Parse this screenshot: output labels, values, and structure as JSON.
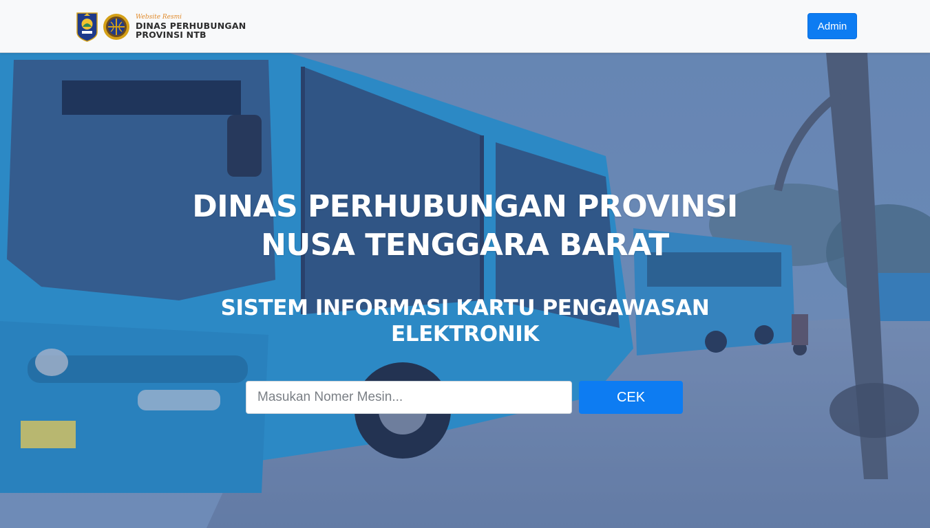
{
  "navbar": {
    "brand": {
      "tagline": "Website Resmi",
      "line1": "DINAS PERHUBUNGAN",
      "line2": "PROVINSI NTB",
      "icons": [
        "ntb-province-emblem-icon",
        "dishub-logo-icon"
      ]
    },
    "admin_label": "Admin"
  },
  "hero": {
    "title_line1": "DINAS PERHUBUNGAN PROVINSI",
    "title_line2": "NUSA TENGGARA BARAT",
    "subtitle_line1": "SISTEM INFORMASI KARTU PENGAWASAN",
    "subtitle_line2": "ELEKTRONIK",
    "search": {
      "placeholder": "Masukan Nomer Mesin...",
      "value": "",
      "button_label": "CEK"
    },
    "background": "bus-station-photo"
  },
  "colors": {
    "primary": "#0d7cf2",
    "navbar_bg": "#f8f9fa",
    "hero_tint": "#6b8fbd",
    "text_on_hero": "#ffffff"
  }
}
